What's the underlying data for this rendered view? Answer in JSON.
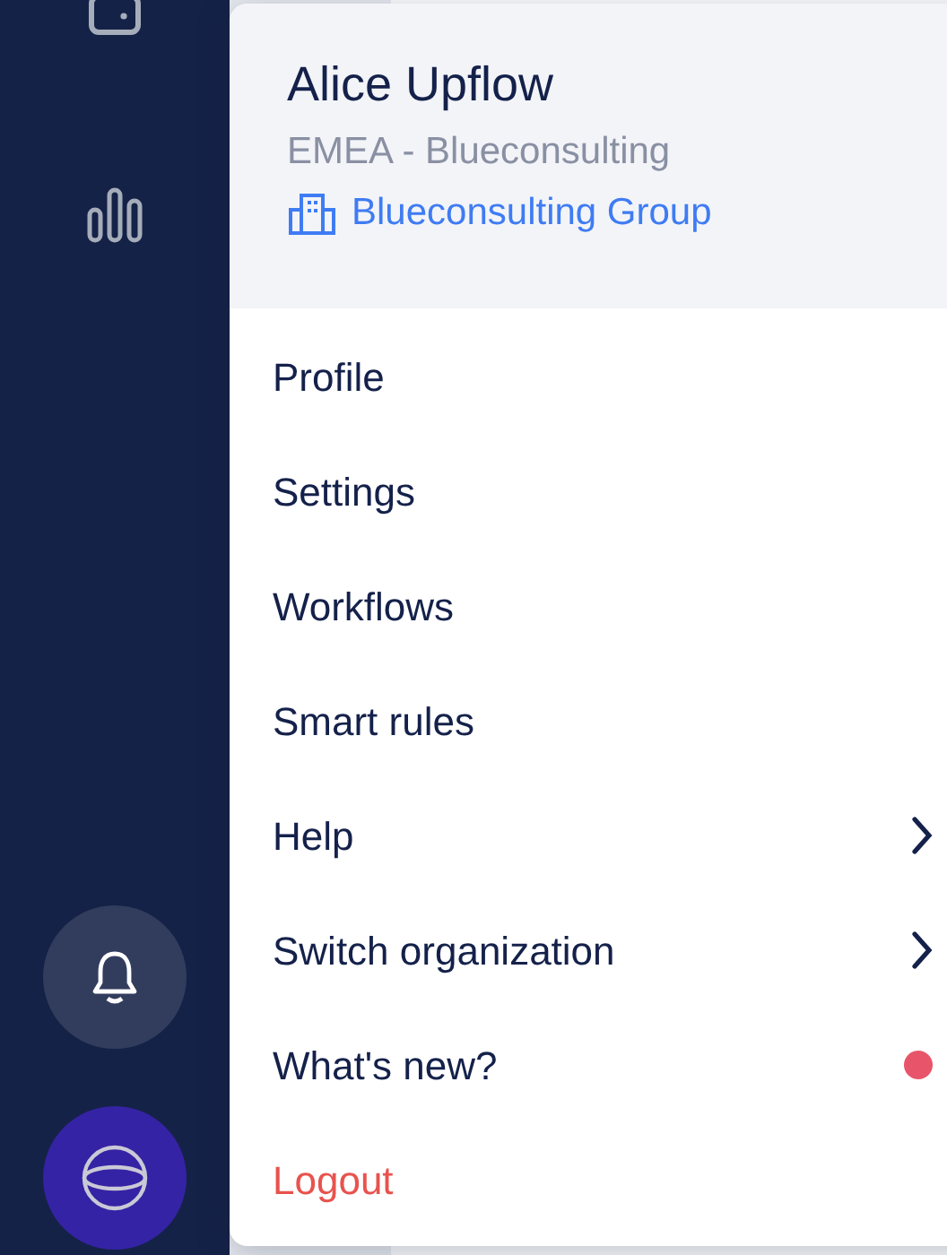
{
  "user": {
    "name": "Alice Upflow",
    "team": "EMEA - Blueconsulting",
    "organization": "Blueconsulting Group"
  },
  "menu_items": [
    {
      "label": "Profile",
      "kind": "plain"
    },
    {
      "label": "Settings",
      "kind": "plain"
    },
    {
      "label": "Workflows",
      "kind": "plain"
    },
    {
      "label": "Smart rules",
      "kind": "plain"
    },
    {
      "label": "Help",
      "kind": "submenu"
    },
    {
      "label": "Switch organization",
      "kind": "submenu"
    },
    {
      "label": "What's new?",
      "kind": "dot"
    },
    {
      "label": "Logout",
      "kind": "logout"
    }
  ]
}
